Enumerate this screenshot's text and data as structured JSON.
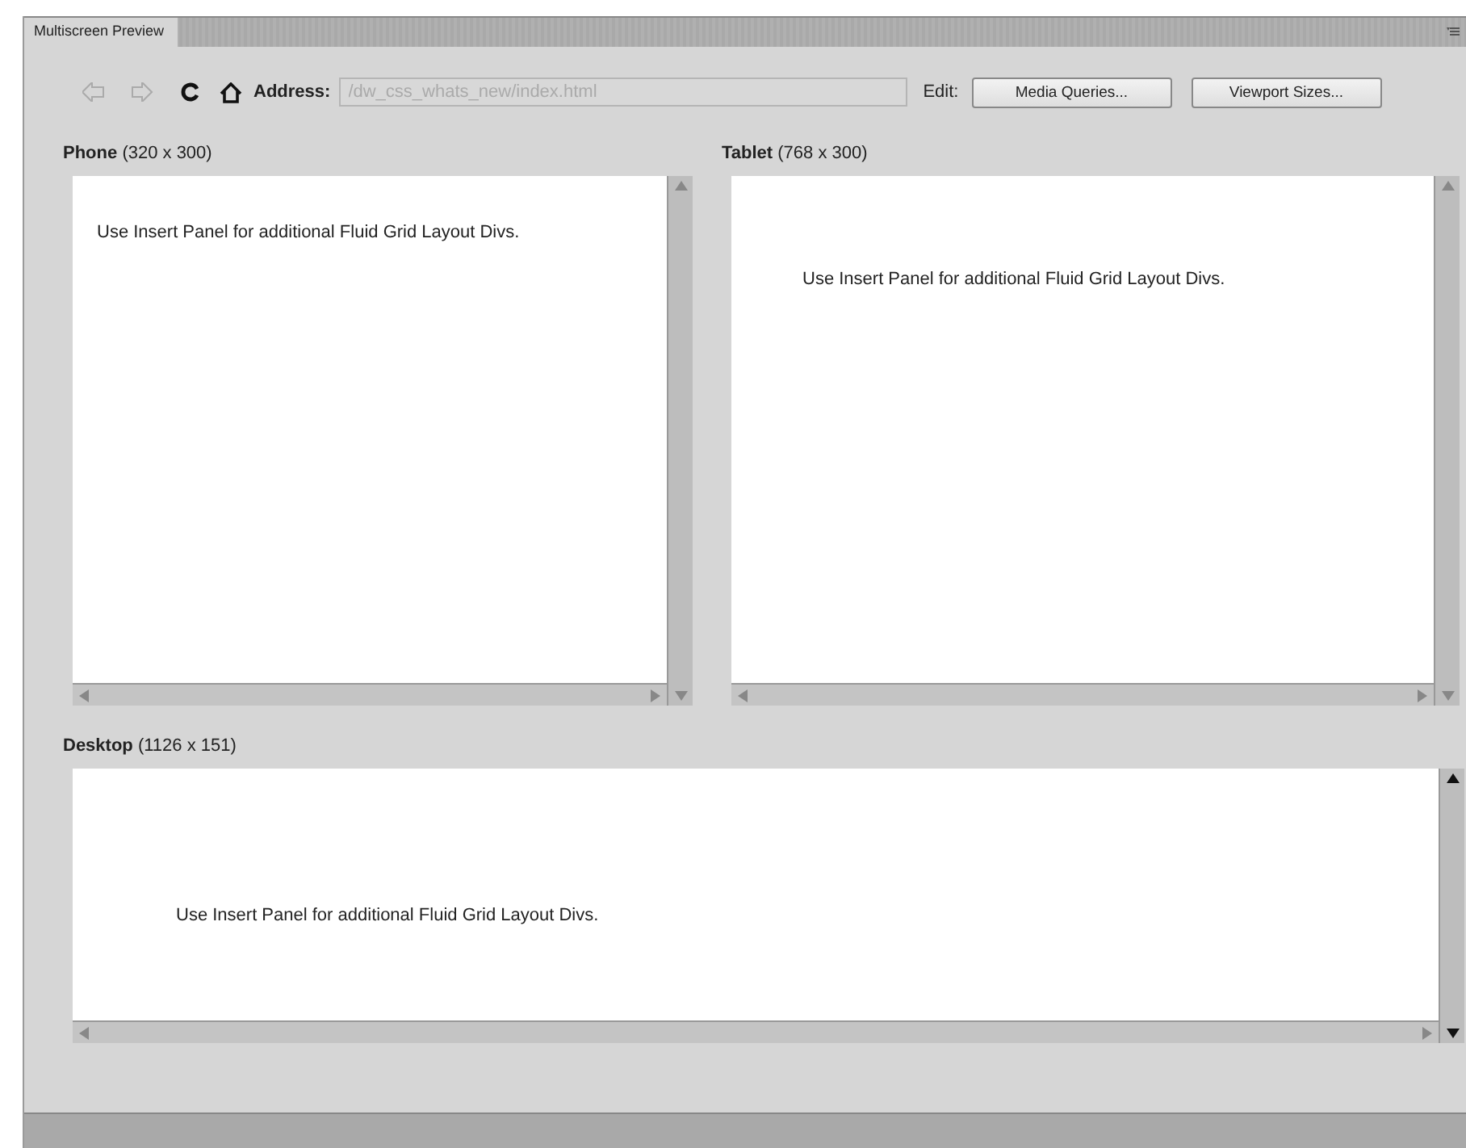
{
  "panel": {
    "tab": "Multiscreen Preview"
  },
  "toolbar": {
    "address_label": "Address:",
    "address_value": "/dw_css_whats_new/index.html",
    "edit_label": "Edit:",
    "buttons": [
      "Media Queries...",
      "Viewport Sizes..."
    ]
  },
  "viewports": [
    {
      "name": "Phone",
      "size": "(320 x 300)",
      "content": "Use Insert Panel for additional Fluid Grid Layout Divs."
    },
    {
      "name": "Tablet",
      "size": "(768 x 300)",
      "content": "Use Insert Panel for additional Fluid Grid Layout Divs."
    },
    {
      "name": "Desktop",
      "size": "(1126 x 151)",
      "content": "Use Insert Panel for additional Fluid Grid Layout Divs."
    }
  ]
}
